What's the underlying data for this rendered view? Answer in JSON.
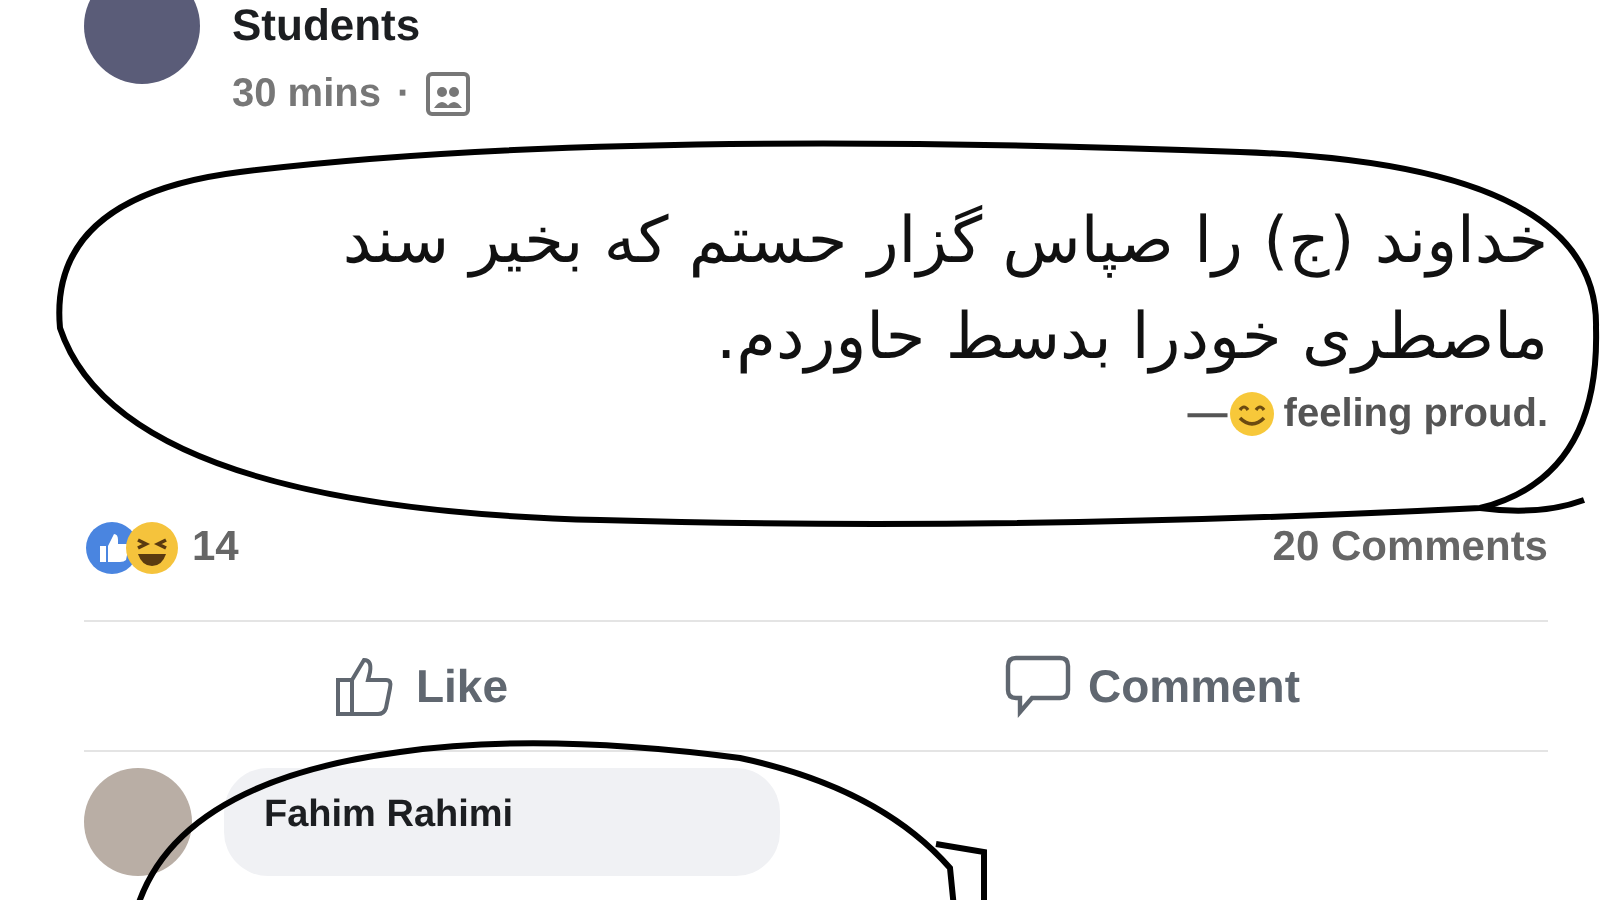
{
  "post": {
    "author": "Students",
    "time": "30 mins",
    "separator": "·",
    "text": "خداوند (ج) را صپاس گزار حستم که بخیر سند ماصطری خودرا بدسط حاوردم.",
    "feeling": {
      "dash": "—",
      "text": "feeling proud."
    }
  },
  "stats": {
    "reaction_count": "14",
    "comments": "20 Comments"
  },
  "actions": [
    {
      "kind": "like",
      "label": "Like"
    },
    {
      "kind": "comment",
      "label": "Comment"
    }
  ],
  "comment": {
    "author": "Fahim Rahimi"
  }
}
